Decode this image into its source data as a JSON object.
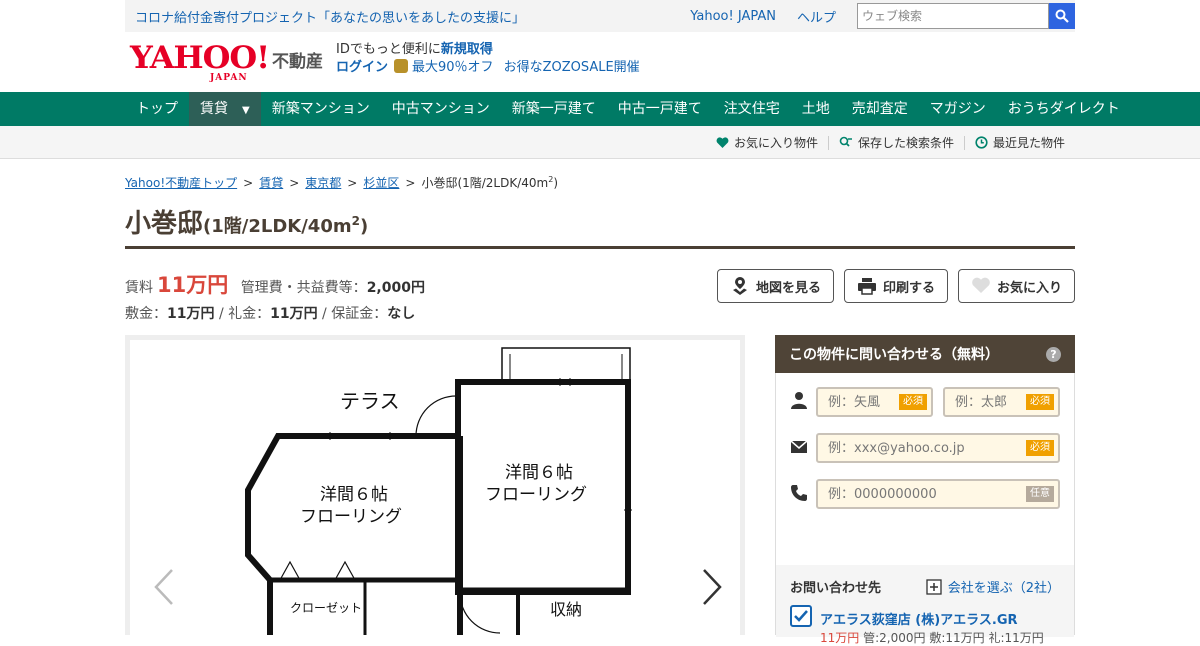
{
  "topbar": {
    "promo": "コロナ給付金寄付プロジェクト「あなたの思いをあしたの支援に」",
    "links": [
      "Yahoo! JAPAN",
      "ヘルプ"
    ],
    "search_placeholder": "ウェブ検索"
  },
  "header": {
    "logo_text": "YAHOO!",
    "logo_sub": "JAPAN",
    "logo_service": "不動産",
    "line1_prefix": "IDでもっと便利に",
    "line1_link": "新規取得",
    "line2_login": "ログイン",
    "line2_coupon": "最大90％オフ",
    "line2_zozo": "お得なZOZOSALE開催"
  },
  "nav": {
    "items": [
      "トップ",
      "賃貸",
      "新築マンション",
      "中古マンション",
      "新築一戸建て",
      "中古一戸建て",
      "注文住宅",
      "土地",
      "売却査定",
      "マガジン",
      "おうちダイレクト"
    ],
    "active_caret": "▼"
  },
  "subnav": {
    "items": [
      "お気に入り物件",
      "保存した検索条件",
      "最近見た物件"
    ]
  },
  "breadcrumb": {
    "items": [
      "Yahoo!不動産トップ",
      "賃貸",
      "東京都",
      "杉並区"
    ],
    "current": "小巻邸(1階/2LDK/40m",
    "current_sup": "2",
    "current_end": ")",
    "sep": ">"
  },
  "property": {
    "title": "小巻邸",
    "subtitle": "(1階/2LDK/40m",
    "subtitle_sup": "2",
    "subtitle_end": ")",
    "rent_label": "賃料",
    "rent": "11万円",
    "fee_label": "管理費・共益費等：",
    "fee": "2,000円",
    "deposit_label": "敷金：",
    "deposit": "11万円",
    "key_label": "礼金：",
    "key_money": "11万円",
    "guarantee_label": "保証金：",
    "guarantee": "なし",
    "slash": "/"
  },
  "actions": {
    "map": "地図を見る",
    "print": "印刷する",
    "favorite": "お気に入り"
  },
  "floorplan": {
    "terrace": "テラス",
    "room1a": "洋間６帖",
    "room1b": "フローリング",
    "room2a": "洋間６帖",
    "room2b": "フローリング",
    "closet": "クローゼット",
    "storage": "収納"
  },
  "inquiry": {
    "title": "この物件に問い合わせる（無料）",
    "help": "?",
    "last_name_placeholder": "例：矢風",
    "first_name_placeholder": "例：太郎",
    "email_placeholder": "例：xxx@yahoo.co.jp",
    "phone_placeholder": "例：0000000000",
    "required": "必須",
    "optional": "任意",
    "contact_label": "お問い合わせ先",
    "choose_company": "会社を選ぶ（2社）",
    "shop_name": "アエラス荻窪店 (株)アエラス.GR",
    "shop_rent": "11万円",
    "shop_detail": "管:2,000円 敷:11万円 礼:11万円"
  }
}
